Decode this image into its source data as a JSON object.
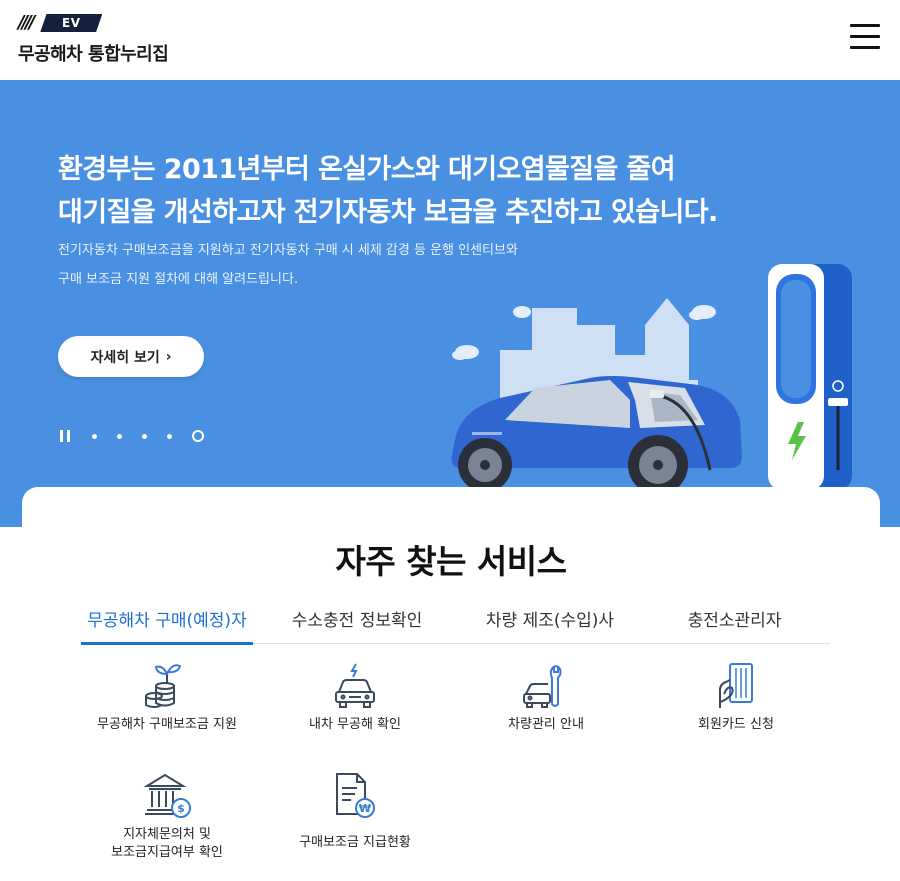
{
  "header": {
    "logo_badge": "EV",
    "logo_text": "무공해차 통합누리집",
    "menu_icon": "hamburger-menu-icon"
  },
  "hero": {
    "title_line1": "환경부는 2011년부터 온실가스와 대기오염물질을 줄여",
    "title_line2": "대기질을 개선하고자 전기자동차 보급을 추진하고 있습니다.",
    "desc_line1": "전기자동차 구매보조금을 지원하고 전기자동차 구매 시 세제 감경 등 운행 인센티브와",
    "desc_line2": "구매 보조금 지원 절차에 대해 알려드립니다.",
    "button_label": "자세히 보기",
    "button_icon": "chevron-right-icon",
    "slide_count": 5,
    "active_slide": 5
  },
  "services": {
    "title": "자주 찾는 서비스",
    "tabs": [
      {
        "label": "무공해차 구매(예정)자",
        "active": true
      },
      {
        "label": "수소충전 정보확인",
        "active": false
      },
      {
        "label": "차량 제조(수입)사",
        "active": false
      },
      {
        "label": "충전소관리자",
        "active": false
      }
    ],
    "items": [
      {
        "label": "무공해차 구매보조금 지원",
        "icon": "coins-plant-icon"
      },
      {
        "label": "내차 무공해 확인",
        "icon": "electric-car-icon"
      },
      {
        "label": "차량관리 안내",
        "icon": "car-wrench-icon"
      },
      {
        "label": "회원카드 신청",
        "icon": "card-hand-icon"
      },
      {
        "label_line1": "지자체문의처 및",
        "label_line2": "보조금지급여부 확인",
        "icon": "bank-dollar-icon"
      },
      {
        "label": "구매보조금 지급현황",
        "icon": "document-won-icon"
      }
    ]
  },
  "colors": {
    "hero_bg": "#4a90e2",
    "accent": "#1c6fd3",
    "icon_stroke": "#3a4a5c",
    "icon_accent": "#3a7bd5"
  }
}
